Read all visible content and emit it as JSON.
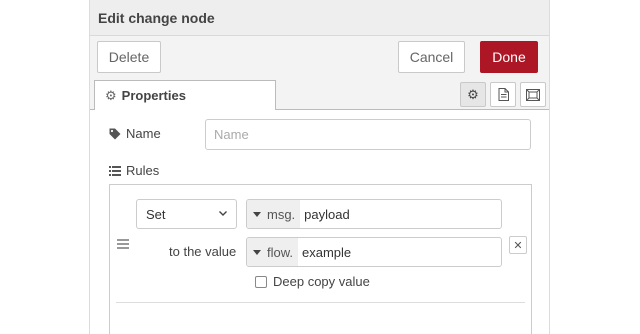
{
  "header": {
    "title": "Edit change node"
  },
  "toolbar": {
    "delete_label": "Delete",
    "cancel_label": "Cancel",
    "done_label": "Done"
  },
  "tabs": {
    "properties_label": "Properties",
    "icons": [
      "gear-icon",
      "file-icon",
      "frame-icon"
    ]
  },
  "form": {
    "name_label": "Name",
    "name_placeholder": "Name",
    "name_value": "",
    "rules_label": "Rules"
  },
  "rules": [
    {
      "action": "Set",
      "target_type": "msg.",
      "target_value": "payload",
      "to_label": "to the value",
      "source_type": "flow.",
      "source_value": "example",
      "deep_copy_label": "Deep copy value",
      "deep_copy_checked": false
    }
  ],
  "colors": {
    "done_button": "#ad1625",
    "panel_background": "#f3f3f3"
  }
}
